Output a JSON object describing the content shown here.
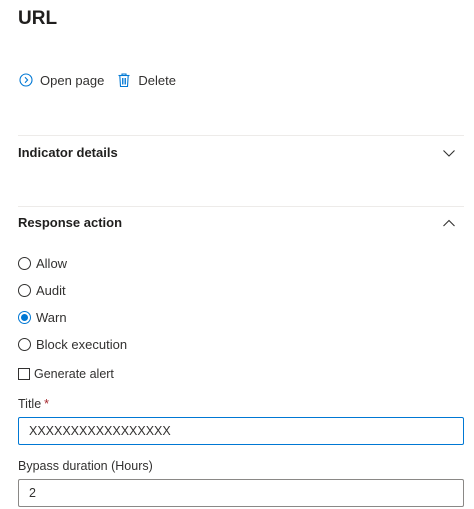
{
  "page": {
    "title": "URL"
  },
  "toolbar": {
    "open_page_label": "Open page",
    "delete_label": "Delete",
    "icons": {
      "open_page": "chevron-circle-right-icon",
      "delete": "trash-icon"
    },
    "icon_color": "#0078d4"
  },
  "sections": {
    "indicator_details": {
      "label": "Indicator details",
      "expanded": false
    },
    "response_action": {
      "label": "Response action",
      "expanded": true
    }
  },
  "response_action": {
    "options": [
      "Allow",
      "Audit",
      "Warn",
      "Block execution"
    ],
    "selected": "Warn",
    "generate_alert_label": "Generate alert",
    "generate_alert_checked": false
  },
  "fields": {
    "title": {
      "label": "Title",
      "required_mark": "*",
      "value": "XXXXXXXXXXXXXXXXX"
    },
    "bypass_duration": {
      "label": "Bypass duration (Hours)",
      "value": "2"
    }
  },
  "colors": {
    "accent": "#0078d4",
    "required": "#a4262c",
    "divider": "#edebe9"
  }
}
